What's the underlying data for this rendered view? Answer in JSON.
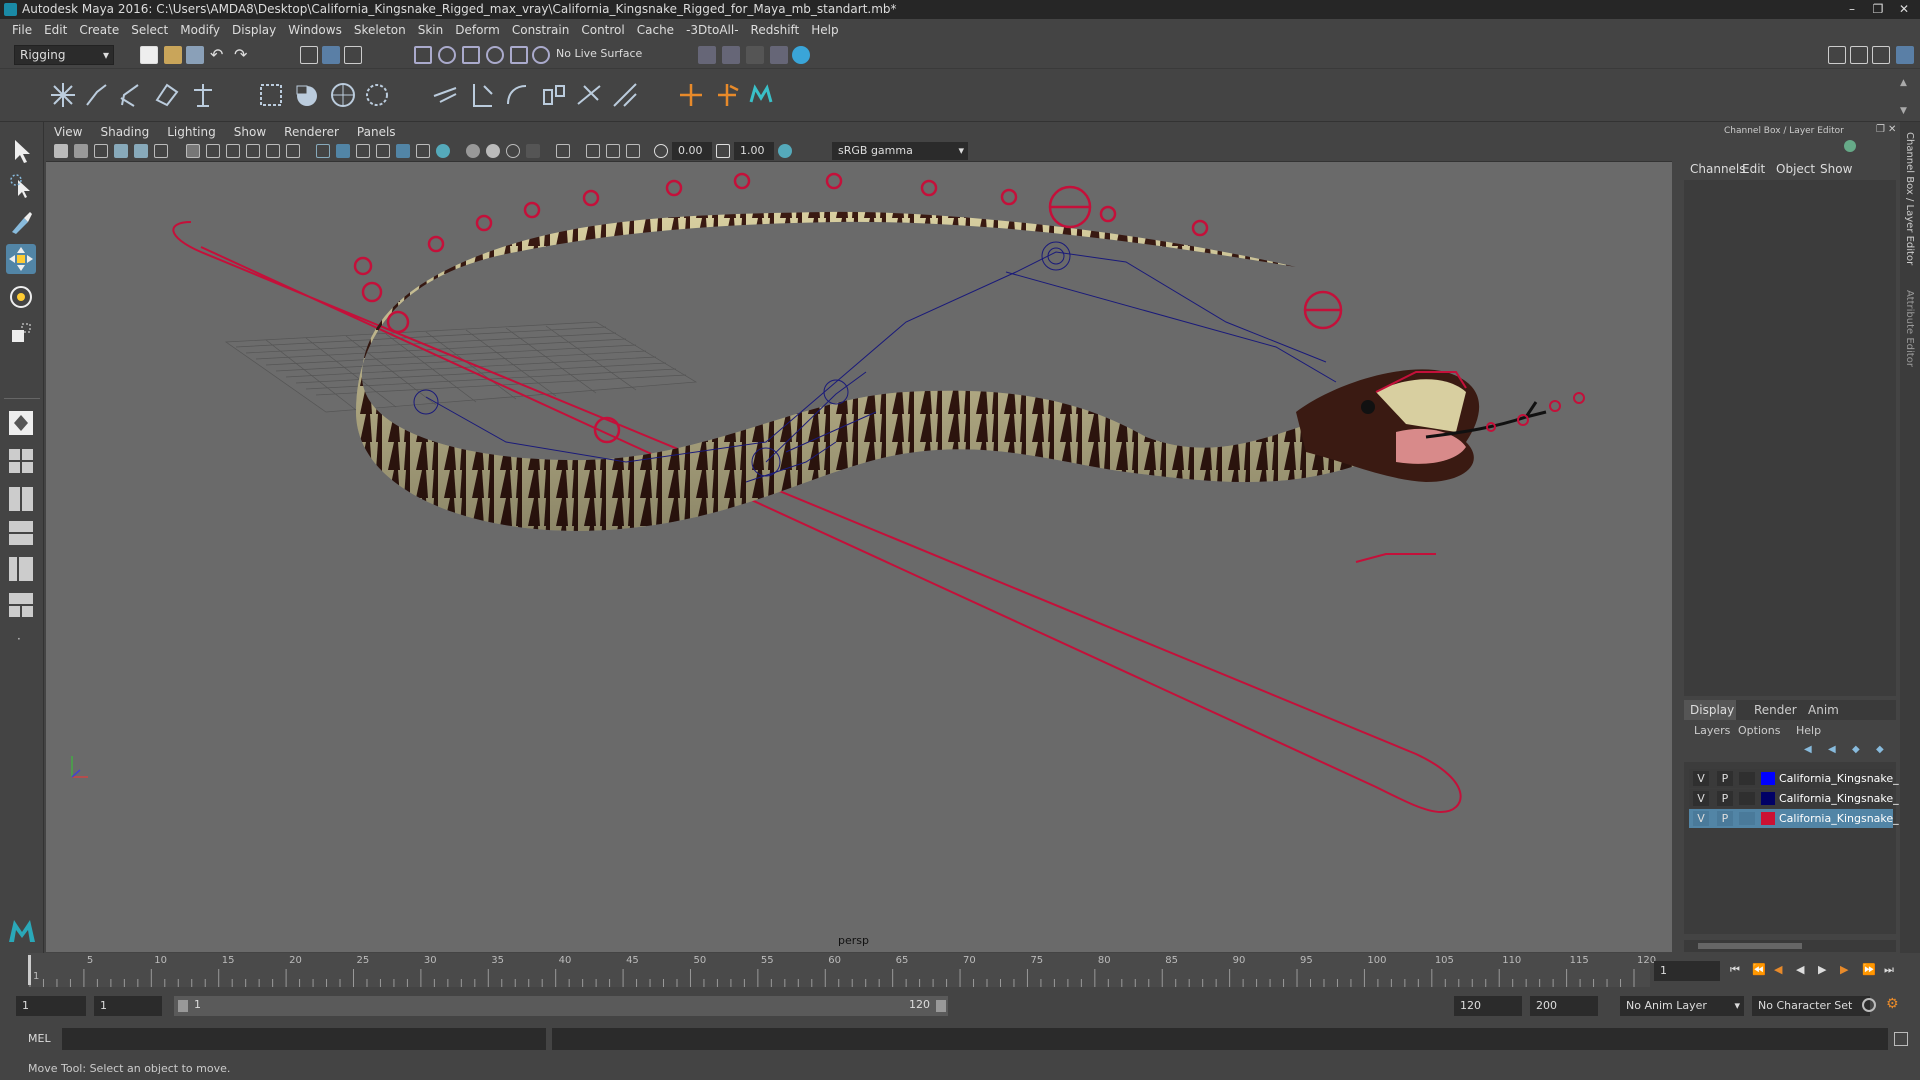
{
  "app": {
    "title": "Autodesk Maya 2016: C:\\Users\\AMDA8\\Desktop\\California_Kingsnake_Rigged_max_vray\\California_Kingsnake_Rigged_for_Maya_mb_standart.mb*"
  },
  "menu": [
    "File",
    "Edit",
    "Create",
    "Select",
    "Modify",
    "Display",
    "Windows",
    "Skeleton",
    "Skin",
    "Deform",
    "Constrain",
    "Control",
    "Cache",
    "-3DtoAll-",
    "Redshift",
    "Help"
  ],
  "shelf": {
    "menuset": "Rigging",
    "live_surface": "No Live Surface"
  },
  "viewport": {
    "menu": [
      "View",
      "Shading",
      "Lighting",
      "Show",
      "Renderer",
      "Panels"
    ],
    "exposure": "0.00",
    "gamma": "1.00",
    "colorspace": "sRGB gamma",
    "camera": "persp"
  },
  "channelbox": {
    "title": "Channel Box / Layer Editor",
    "tabs": [
      "Channels",
      "Edit",
      "Object",
      "Show"
    ],
    "side_tabs": [
      "Channel Box / Layer Editor",
      "Attribute Editor"
    ]
  },
  "layers": {
    "tabs": [
      "Display",
      "Render",
      "Anim"
    ],
    "menu": [
      "Layers",
      "Options",
      "Help"
    ],
    "rows": [
      {
        "v": "V",
        "p": "P",
        "color": "#0000ff",
        "name": "California_Kingsnake_"
      },
      {
        "v": "V",
        "p": "P",
        "color": "#000066",
        "name": "California_Kingsnake_"
      },
      {
        "v": "V",
        "p": "P",
        "color": "#cc1133",
        "name": "California_Kingsnake_"
      }
    ]
  },
  "timeline": {
    "ticks": [
      "1",
      "5",
      "10",
      "15",
      "20",
      "25",
      "30",
      "35",
      "40",
      "45",
      "50",
      "55",
      "60",
      "65",
      "70",
      "75",
      "80",
      "85",
      "90",
      "95",
      "100",
      "105",
      "110",
      "115",
      "120"
    ],
    "current": "1"
  },
  "range": {
    "start": "1",
    "anim_start": "1",
    "slider_start": "1",
    "slider_end": "120",
    "end": "120",
    "anim_end": "200",
    "anim_layer": "No Anim Layer",
    "char_set": "No Character Set"
  },
  "cmd": {
    "lang": "MEL"
  },
  "help": "Move Tool: Select an object to move."
}
